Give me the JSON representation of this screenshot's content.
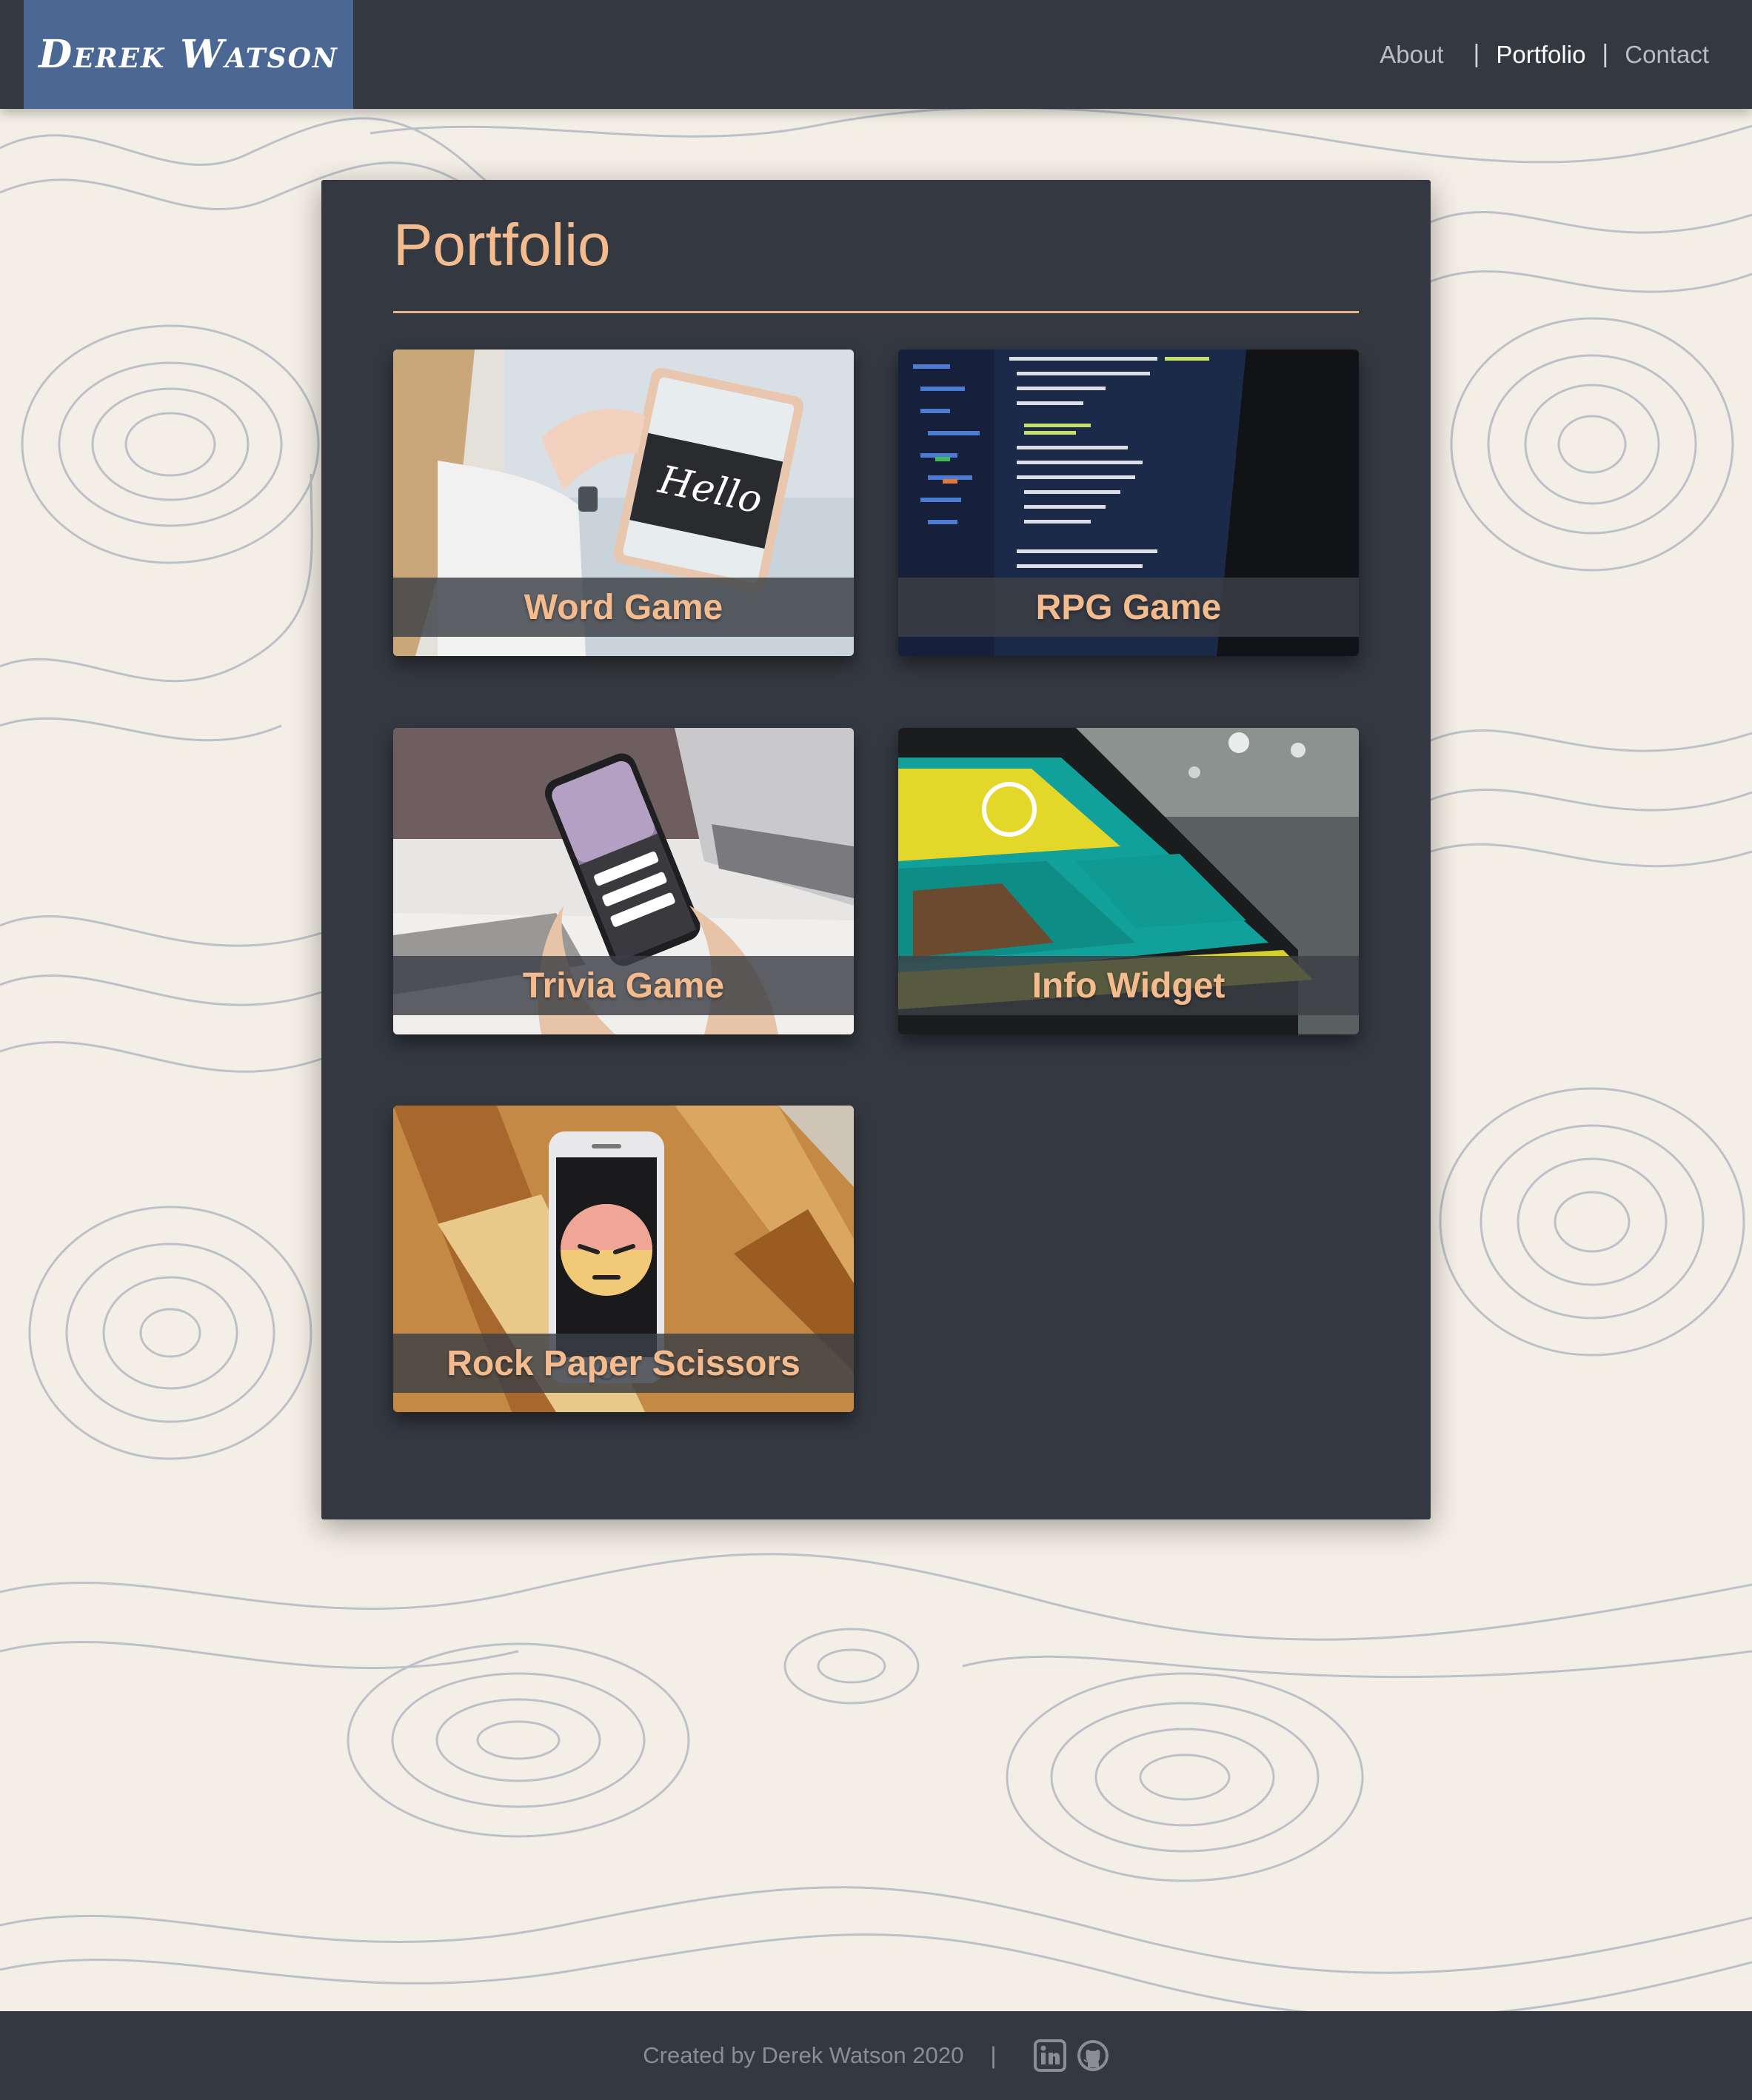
{
  "header": {
    "brand": "Derek Watson",
    "nav": [
      {
        "label": "About",
        "active": false
      },
      {
        "label": "Portfolio",
        "active": true
      },
      {
        "label": "Contact",
        "active": false
      }
    ],
    "separator": "|"
  },
  "main": {
    "title": "Portfolio",
    "projects": [
      {
        "label": "Word Game",
        "icon": "tablet-image"
      },
      {
        "label": "RPG Game",
        "icon": "code-laptop-image"
      },
      {
        "label": "Trivia Game",
        "icon": "phone-in-hand-image"
      },
      {
        "label": "Info Widget",
        "icon": "phone-app-image"
      },
      {
        "label": "Rock Paper Scissors",
        "icon": "phone-angry-emoji-image"
      }
    ]
  },
  "footer": {
    "text": "Created by Derek Watson 2020",
    "separator": "|",
    "icons": [
      "linkedin-icon",
      "github-icon"
    ]
  },
  "colors": {
    "navbar": "#343840",
    "brand_bg": "#4a6893",
    "accent": "#f4bc8e",
    "page_bg": "#f3efe6"
  }
}
